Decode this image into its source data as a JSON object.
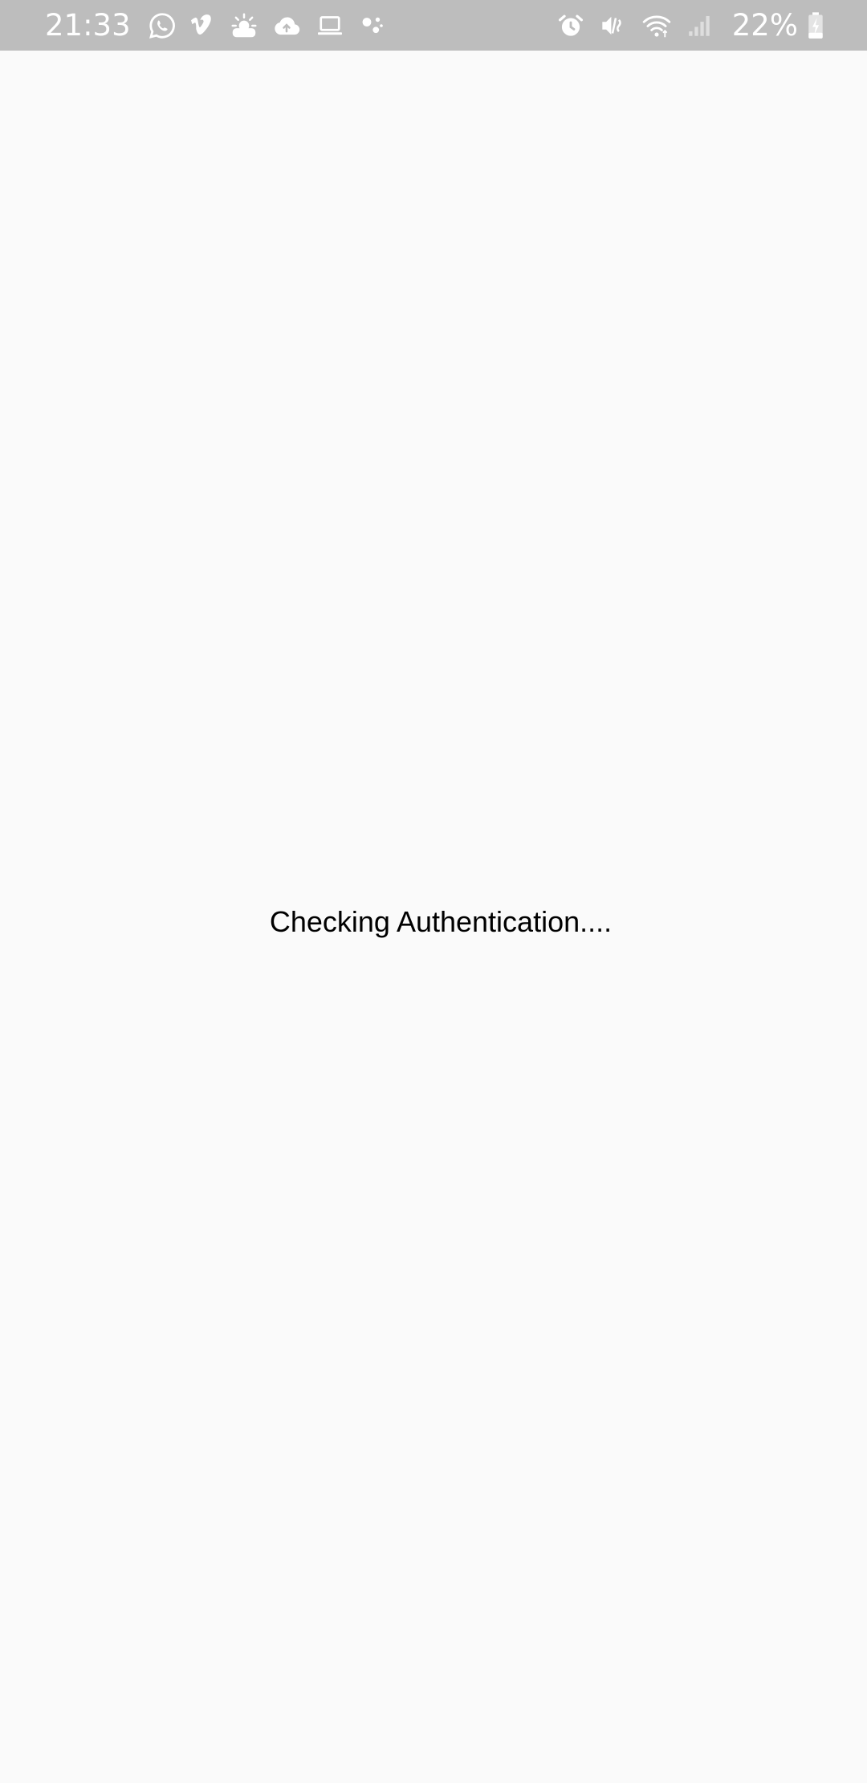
{
  "status_bar": {
    "time": "21:33",
    "battery_percent": "22%",
    "left_icons": [
      "whatsapp-icon",
      "vimeo-icon",
      "weather-icon",
      "cloud-upload-icon",
      "laptop-icon",
      "assistant-icon"
    ],
    "right_icons": [
      "alarm-icon",
      "vibrate-icon",
      "wifi-icon",
      "signal-icon",
      "battery-charging-icon"
    ],
    "background_color": "#bdbdbd"
  },
  "main": {
    "message": "Checking Authentication....",
    "background_color": "#fafafa",
    "text_color": "#000000"
  }
}
